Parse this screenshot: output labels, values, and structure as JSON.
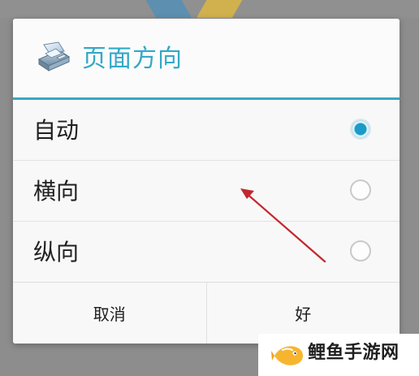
{
  "dialog": {
    "title": "页面方向",
    "icon_name": "printer-icon",
    "accent_color": "#37a8c2",
    "options": [
      {
        "label": "自动",
        "selected": true
      },
      {
        "label": "横向",
        "selected": false
      },
      {
        "label": "纵向",
        "selected": false
      }
    ],
    "buttons": {
      "cancel": "取消",
      "ok": "好"
    }
  },
  "watermark": {
    "text": "鲤鱼手游网",
    "logo_name": "fish-logo"
  }
}
